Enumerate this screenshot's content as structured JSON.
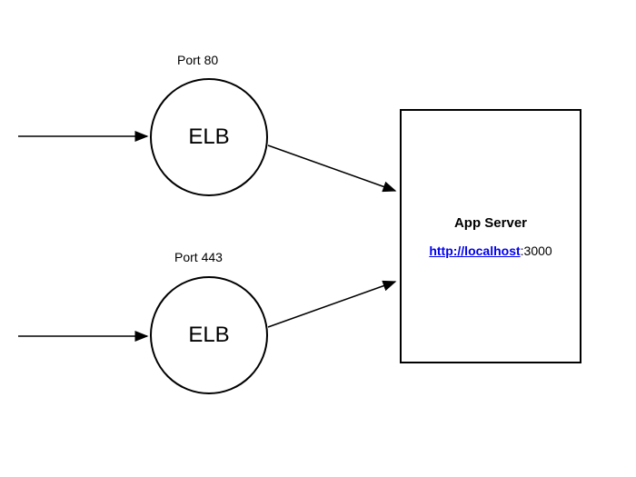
{
  "labels": {
    "port80": "Port 80",
    "port443": "Port 443",
    "elb1": "ELB",
    "elb2": "ELB"
  },
  "server": {
    "title": "App Server",
    "url_link": "http://localhost",
    "url_port": ":3000"
  }
}
